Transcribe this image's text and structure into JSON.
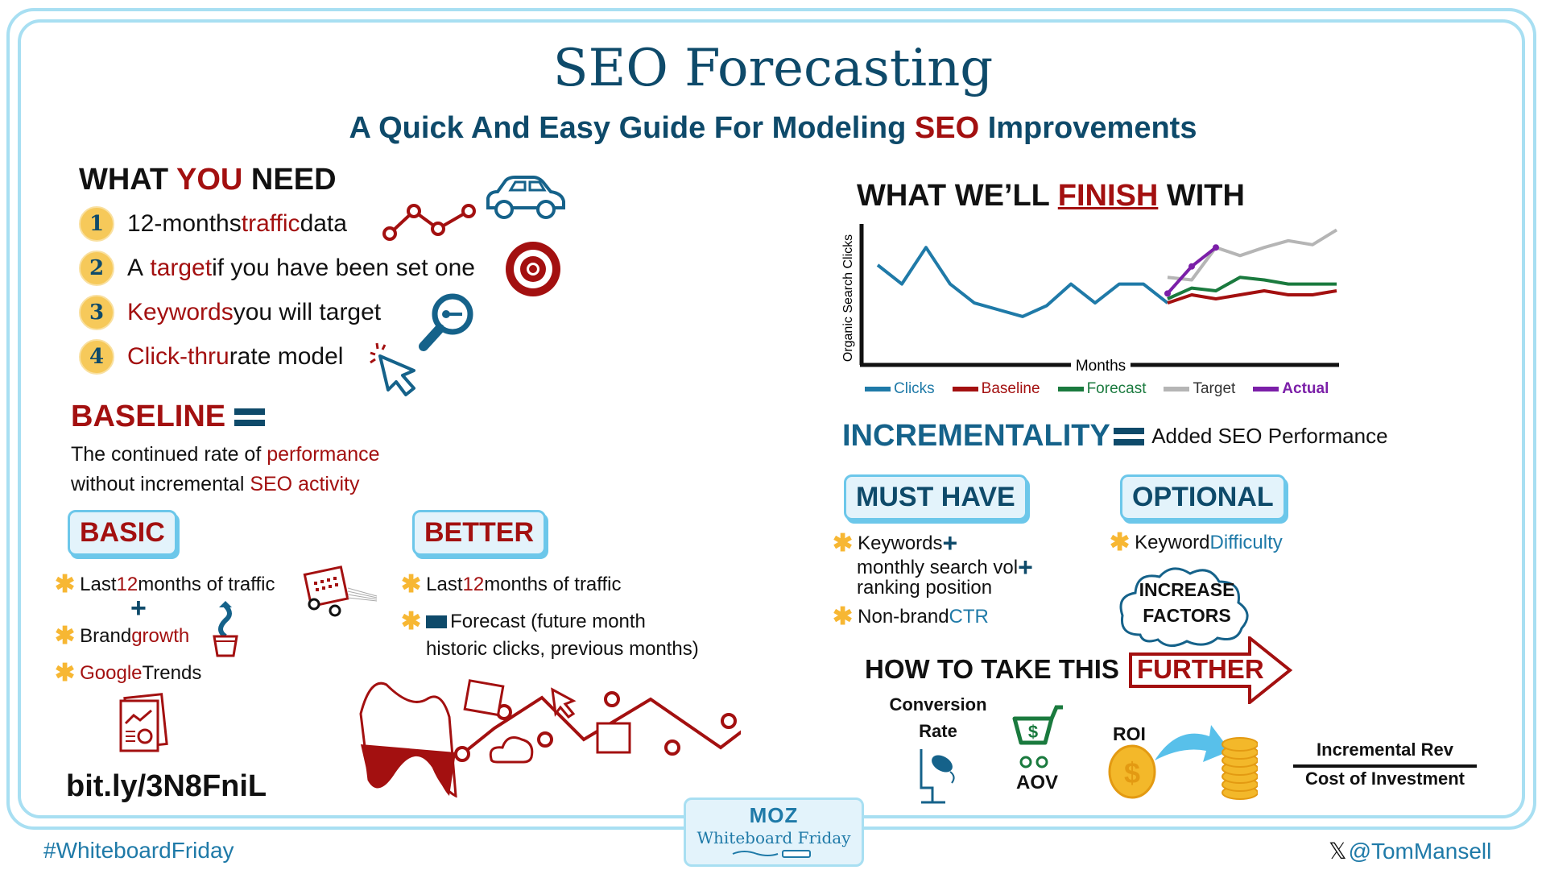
{
  "header": {
    "title": "SEO Forecasting",
    "subtitle_parts": [
      "A Quick And Easy Guide For Modeling ",
      "SEO",
      " Improvements"
    ]
  },
  "what_you_need": {
    "heading_parts": [
      "WHAT ",
      "YOU",
      " NEED"
    ],
    "items": [
      {
        "number": "1",
        "parts": [
          "12-months ",
          "traffic",
          " data"
        ],
        "icon": "line-chart-icon"
      },
      {
        "number": "2",
        "parts": [
          "A ",
          "target",
          " if you have been set one"
        ],
        "icon": "target-icon"
      },
      {
        "number": "3",
        "parts": [
          "Keywords",
          " you will target",
          ""
        ],
        "icon": "magnifier-key-icon"
      },
      {
        "number": "4",
        "parts": [
          "Click-thru",
          " rate model",
          ""
        ],
        "icon": "cursor-click-icon"
      }
    ],
    "extra_icons": [
      "car-icon"
    ]
  },
  "baseline": {
    "heading": "BASELINE",
    "line1_parts": [
      "The continued rate of ",
      "performance"
    ],
    "line2_parts": [
      "without incremental ",
      "SEO activity"
    ]
  },
  "basic": {
    "label": "BASIC",
    "items": [
      {
        "parts": [
          "Last ",
          "12",
          " months of traffic"
        ]
      },
      {
        "parts": [
          "Brand ",
          "growth",
          ""
        ]
      },
      {
        "parts": [
          "",
          "Google",
          " Trends"
        ]
      }
    ],
    "plus": "+"
  },
  "better": {
    "label": "BETTER",
    "items": [
      {
        "parts": [
          "Last ",
          "12",
          " months of traffic"
        ]
      },
      {
        "line1": "Forecast (future month",
        "line2": "historic clicks, previous months)"
      }
    ]
  },
  "link": "bit.ly/3N8FniL",
  "finish": {
    "heading_parts": [
      "WHAT WE’LL ",
      "FINISH",
      " WITH"
    ]
  },
  "chart_data": {
    "type": "line",
    "title": "",
    "xlabel": "Months",
    "ylabel": "Organic Search Clicks",
    "ylim": [
      0,
      100
    ],
    "x_count": 20,
    "grid": false,
    "legend_position": "bottom",
    "series": [
      {
        "name": "Clicks",
        "color": "#1f7aa8",
        "start": 0,
        "values": [
          72,
          58,
          85,
          58,
          44,
          39,
          34,
          42,
          58,
          44,
          58,
          58,
          44
        ]
      },
      {
        "name": "Baseline",
        "color": "#a31010",
        "start": 12,
        "values": [
          44,
          50,
          47,
          50,
          53,
          50,
          50,
          53
        ]
      },
      {
        "name": "Forecast",
        "color": "#1a7a3e",
        "start": 12,
        "values": [
          47,
          55,
          53,
          63,
          61,
          58,
          58,
          58
        ]
      },
      {
        "name": "Target",
        "color": "#b5b5b5",
        "start": 12,
        "values": [
          63,
          61,
          85,
          79,
          85,
          90,
          87,
          98
        ]
      },
      {
        "name": "Actual",
        "color": "#7b1fa8",
        "start": 12,
        "values": [
          51,
          71,
          85
        ],
        "markers": true
      }
    ]
  },
  "incrementality": {
    "heading": "INCREMENTALITY",
    "definition": "Added SEO Performance"
  },
  "must_have": {
    "label": "MUST HAVE",
    "item1_lines": [
      "Keywords",
      "monthly search vol",
      "ranking position"
    ],
    "item2_parts": [
      "Non-brand ",
      "CTR"
    ]
  },
  "optional": {
    "label": "OPTIONAL",
    "item_parts": [
      "Keyword ",
      "Difficulty"
    ],
    "cloud_lines": [
      "INCREASE",
      "FACTORS"
    ]
  },
  "further": {
    "heading": "HOW TO TAKE THIS",
    "arrow_label": "FURTHER",
    "conversion_lines": [
      "Conversion",
      "Rate"
    ],
    "aov": "AOV",
    "roi": "ROI",
    "numerator": "Incremental Rev",
    "denominator": "Cost of Investment"
  },
  "footer": {
    "hashtag": "#WhiteboardFriday",
    "brand": "MOZ",
    "brand_sub": "Whiteboard Friday",
    "handle": "@TomMansell",
    "x_icon": "𝕏"
  }
}
